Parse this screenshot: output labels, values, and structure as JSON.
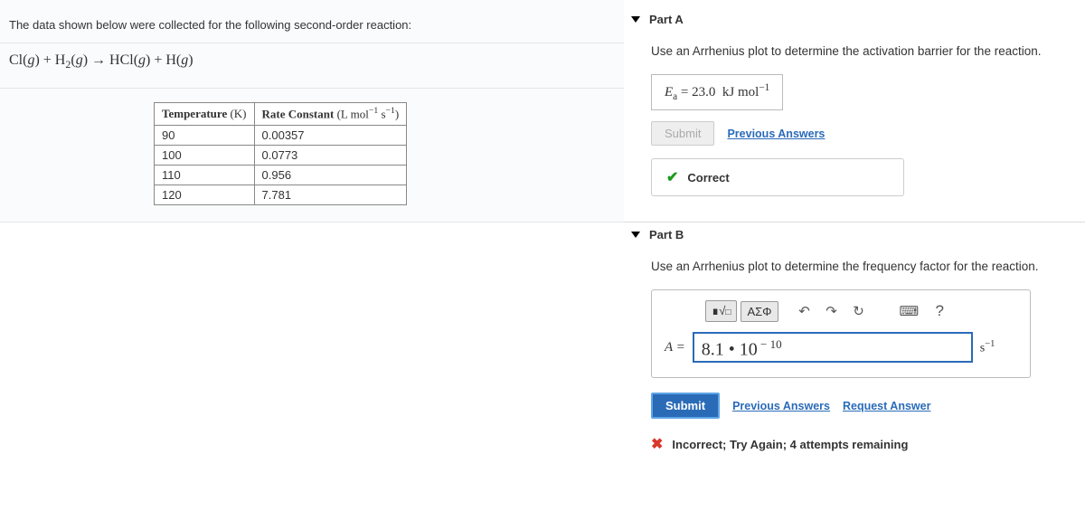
{
  "problem": {
    "statement": "The data shown below were collected for the following second-order reaction:",
    "equation_html": "Cl(<i>g</i>) + H<sub>2</sub>(<i>g</i>) → HCl(<i>g</i>) + H(<i>g</i>)",
    "table": {
      "headers": {
        "col1_html": "<b>Temperature</b> (K)",
        "col2_html": "<b>Rate Constant</b> (L mol<sup>−1</sup> s<sup>−1</sup>)"
      },
      "rows": [
        {
          "temp": "90",
          "rate": "0.00357"
        },
        {
          "temp": "100",
          "rate": "0.0773"
        },
        {
          "temp": "110",
          "rate": "0.956"
        },
        {
          "temp": "120",
          "rate": "7.781"
        }
      ]
    }
  },
  "partA": {
    "title": "Part A",
    "prompt": "Use an Arrhenius plot to determine the activation barrier for the reaction.",
    "answer_html": "<i>E</i><sub>a</sub> = 23.0&nbsp; kJ mol<sup>−1</sup>",
    "submit_label": "Submit",
    "prev_label": "Previous Answers",
    "feedback": "Correct"
  },
  "partB": {
    "title": "Part B",
    "prompt": "Use an Arrhenius plot to determine the frequency factor for the reaction.",
    "toolbar": {
      "templates_html": "∎√<span style='font-size:10px'>□</span>",
      "greek": "ΑΣΦ",
      "undo": "↶",
      "redo": "↷",
      "reset": "↻",
      "keyboard": "⌨",
      "help": "?"
    },
    "var_label_html": "<i>A</i> =",
    "input_value_html": "8.1 • 10<sup style='font-size:0.65em'> − 10</sup>",
    "unit_html": "s<sup>−1</sup>",
    "submit_label": "Submit",
    "prev_label": "Previous Answers",
    "request_label": "Request Answer",
    "feedback": "Incorrect; Try Again; 4 attempts remaining"
  }
}
